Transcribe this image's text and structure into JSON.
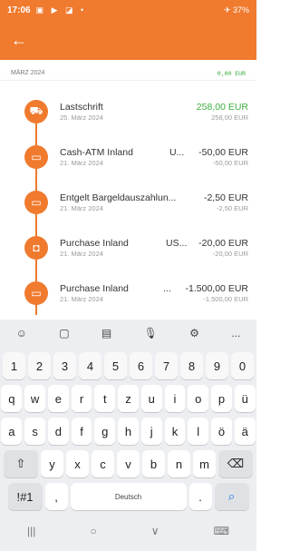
{
  "status": {
    "time": "17:06",
    "left_icons": "▣ ▶ ◪ •",
    "right": "✈ 37%"
  },
  "month": {
    "label": "MÄRZ 2024",
    "total": "0,00 EUR"
  },
  "transactions": [
    {
      "name": "Lastschrift",
      "extra": "",
      "date": "25. März 2024",
      "amount": "258,00 EUR",
      "sub": "258,00 EUR",
      "positive": true,
      "icon": "cart-icon"
    },
    {
      "name": "Cash-ATM Inland",
      "extra": "U...",
      "date": "21. März 2024",
      "amount": "-50,00 EUR",
      "sub": "-50,00 EUR",
      "positive": false,
      "icon": "card-icon"
    },
    {
      "name": "Entgelt Bargeldauszahlun...",
      "extra": "",
      "date": "21. März 2024",
      "amount": "-2,50 EUR",
      "sub": "-2,50 EUR",
      "positive": false,
      "icon": "card-icon"
    },
    {
      "name": "Purchase Inland",
      "extra": "US...",
      "date": "21. März 2024",
      "amount": "-20,00 EUR",
      "sub": "-20,00 EUR",
      "positive": false,
      "icon": "shopping-bag-icon"
    },
    {
      "name": "Purchase Inland",
      "extra": "...",
      "date": "21. März 2024",
      "amount": "-1.500,00 EUR",
      "sub": "-1.500,00 EUR",
      "positive": false,
      "icon": "card-icon"
    }
  ],
  "keyboard": {
    "toolbar": [
      "☺",
      "▢",
      "▤",
      "🎙",
      "⚙",
      "..."
    ],
    "numbers": [
      "1",
      "2",
      "3",
      "4",
      "5",
      "6",
      "7",
      "8",
      "9",
      "0"
    ],
    "row1": [
      "q",
      "w",
      "e",
      "r",
      "t",
      "z",
      "u",
      "i",
      "o",
      "p",
      "ü"
    ],
    "row2": [
      "a",
      "s",
      "d",
      "f",
      "g",
      "h",
      "j",
      "k",
      "l",
      "ö",
      "ä"
    ],
    "row3": [
      "y",
      "x",
      "c",
      "v",
      "b",
      "n",
      "m"
    ],
    "shift": "⇧",
    "backspace": "⌫",
    "symbols": "!#1",
    "comma": ",",
    "space": "Deutsch",
    "period": ".",
    "search": "⌕"
  },
  "navbar": {
    "recents": "|||",
    "home": "○",
    "back": "∨",
    "keyboard": "⌨"
  },
  "colors": {
    "accent": "#f07a2e",
    "positive": "#3fae3f"
  }
}
